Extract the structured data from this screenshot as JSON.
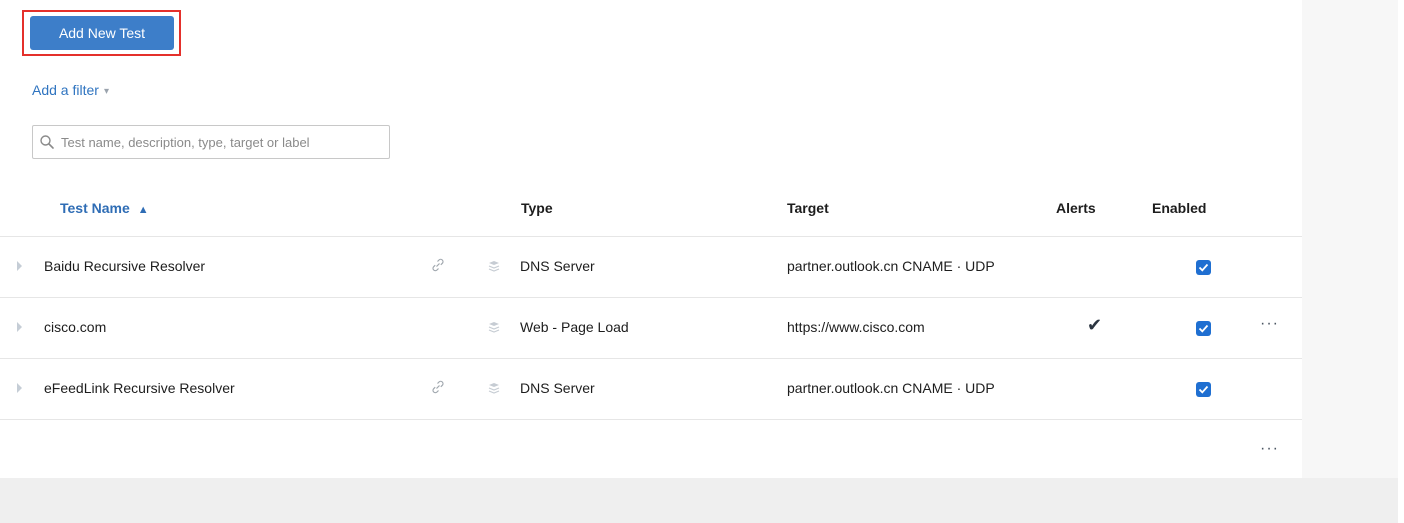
{
  "toolbar": {
    "add_button_label": "Add New Test",
    "filter_label": "Add a filter",
    "filter_caret": "▾"
  },
  "search": {
    "placeholder": "Test name, description, type, target or label",
    "value": ""
  },
  "table": {
    "columns": {
      "name": "Test Name",
      "name_sort": "▲",
      "type": "Type",
      "target": "Target",
      "alerts": "Alerts",
      "enabled": "Enabled"
    },
    "rows": [
      {
        "name": "Baidu Recursive Resolver",
        "has_link": true,
        "type": "DNS Server",
        "target": "partner.outlook.cn CNAME · UDP",
        "alerts": false,
        "enabled": true,
        "has_more": false
      },
      {
        "name": "cisco.com",
        "has_link": false,
        "type": "Web - Page Load",
        "target": "https://www.cisco.com",
        "alerts": true,
        "enabled": true,
        "has_more": true
      },
      {
        "name": "eFeedLink Recursive Resolver",
        "has_link": true,
        "type": "DNS Server",
        "target": "partner.outlook.cn CNAME · UDP",
        "alerts": false,
        "enabled": true,
        "has_more": false
      }
    ],
    "alert_glyph": "✔",
    "more_glyph": "···"
  },
  "colors": {
    "accent": "#3d7ec9",
    "link": "#2f74c0",
    "highlight": "#e4302b",
    "checkbox": "#1f6fd1"
  }
}
